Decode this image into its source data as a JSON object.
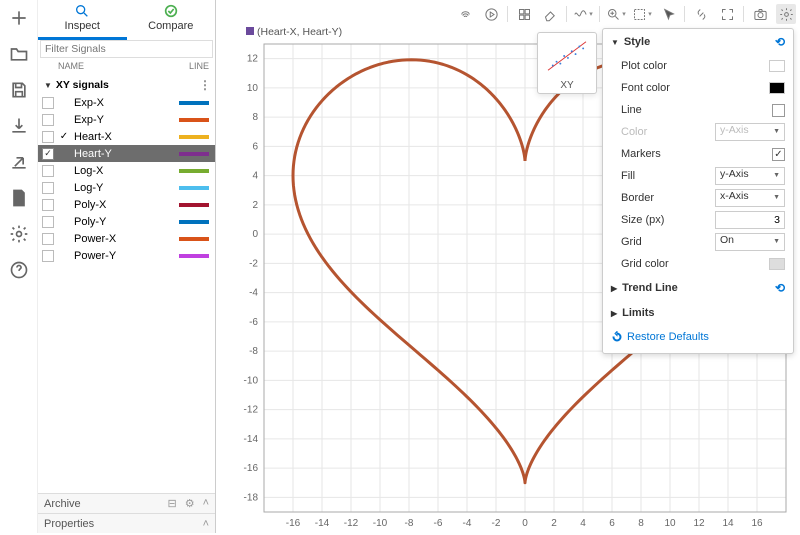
{
  "rail_tools": [
    "plus",
    "folder",
    "save",
    "download",
    "export",
    "document",
    "gear",
    "help"
  ],
  "tabs": {
    "inspect": "Inspect",
    "compare": "Compare"
  },
  "panel": {
    "filter_placeholder": "Filter Signals",
    "col_name": "NAME",
    "col_line": "LINE",
    "group": "XY signals",
    "signals": [
      {
        "name": "Exp-X",
        "color": "#0072bd",
        "checked": false,
        "sel": false,
        "tick": false
      },
      {
        "name": "Exp-Y",
        "color": "#d95319",
        "checked": false,
        "sel": false,
        "tick": false
      },
      {
        "name": "Heart-X",
        "color": "#edb120",
        "checked": false,
        "sel": false,
        "tick": true
      },
      {
        "name": "Heart-Y",
        "color": "#7e2f8e",
        "checked": true,
        "sel": true,
        "tick": false
      },
      {
        "name": "Log-X",
        "color": "#77ac30",
        "checked": false,
        "sel": false,
        "tick": false
      },
      {
        "name": "Log-Y",
        "color": "#4dbeee",
        "checked": false,
        "sel": false,
        "tick": false
      },
      {
        "name": "Poly-X",
        "color": "#a2142f",
        "checked": false,
        "sel": false,
        "tick": false
      },
      {
        "name": "Poly-Y",
        "color": "#0072bd",
        "checked": false,
        "sel": false,
        "tick": false
      },
      {
        "name": "Power-X",
        "color": "#d95319",
        "checked": false,
        "sel": false,
        "tick": false
      },
      {
        "name": "Power-Y",
        "color": "#c040e0",
        "checked": false,
        "sel": false,
        "tick": false
      }
    ],
    "archive": "Archive",
    "properties": "Properties"
  },
  "plot": {
    "title_pair": "(Heart-X, Heart-Y)",
    "x_ticks": [
      -16,
      -14,
      -12,
      -10,
      -8,
      -6,
      -4,
      -2,
      0,
      2,
      4,
      6,
      8,
      10,
      12,
      14,
      16
    ],
    "y_ticks": [
      -18,
      -16,
      -14,
      -12,
      -10,
      -8,
      -6,
      -4,
      -2,
      0,
      2,
      4,
      6,
      8,
      10,
      12
    ],
    "x_range": [
      -18,
      18
    ],
    "y_range": [
      -19,
      13
    ]
  },
  "popover": {
    "thumb_label": "XY",
    "style_head": "Style",
    "plot_color": "Plot color",
    "font_color": "Font color",
    "line": "Line",
    "color": "Color",
    "color_val": "y-Axis",
    "markers": "Markers",
    "fill": "Fill",
    "fill_val": "y-Axis",
    "border": "Border",
    "border_val": "x-Axis",
    "size": "Size (px)",
    "size_val": "3",
    "grid": "Grid",
    "grid_val": "On",
    "grid_color": "Grid color",
    "trend": "Trend Line",
    "limits": "Limits",
    "restore": "Restore Defaults"
  },
  "chart_data": {
    "type": "line",
    "title": "(Heart-X, Heart-Y)",
    "xlabel": "",
    "ylabel": "",
    "xlim": [
      -18,
      18
    ],
    "ylim": [
      -19,
      13
    ],
    "series": [
      {
        "name": "Heart",
        "parametric": true,
        "description": "Parametric heart curve x=16 sin^3 t, y=13 cos t - 5 cos 2t - 2 cos 3t - cos 4t, t in [0, 2π]",
        "x": [
          0.0,
          0.49,
          1.83,
          3.73,
          5.82,
          7.84,
          9.61,
          11.06,
          12.15,
          12.91,
          13.38,
          13.61,
          13.66,
          13.57,
          13.36,
          13.05,
          12.64,
          12.12,
          11.47,
          10.68,
          9.73,
          8.64,
          7.42,
          6.1,
          4.72,
          3.35,
          2.06,
          0.94,
          0.1,
          -0.1,
          -0.94,
          -2.06,
          -3.35,
          -4.72,
          -6.1,
          -7.42,
          -8.64,
          -9.73,
          -10.68,
          -11.47,
          -12.12,
          -12.64,
          -13.05,
          -13.36,
          -13.57,
          -13.66,
          -13.61,
          -13.38,
          -12.91,
          -12.15,
          -11.06,
          -9.61,
          -7.84,
          -5.82,
          -3.73,
          -1.83,
          -0.49,
          0.0
        ],
        "y": [
          5.0,
          6.76,
          8.48,
          10.0,
          11.12,
          11.75,
          11.9,
          11.64,
          11.09,
          10.33,
          9.44,
          8.47,
          7.43,
          6.33,
          5.15,
          3.87,
          2.48,
          0.99,
          -0.57,
          -2.18,
          -3.78,
          -5.31,
          -6.73,
          -8.01,
          -9.13,
          -10.12,
          -11.05,
          -12.03,
          -13.26,
          -13.26,
          -12.03,
          -11.05,
          -10.12,
          -9.13,
          -8.01,
          -6.73,
          -5.31,
          -3.78,
          -2.18,
          -0.57,
          0.99,
          2.48,
          3.87,
          5.15,
          6.33,
          7.43,
          8.47,
          9.44,
          10.33,
          11.09,
          11.64,
          11.9,
          11.75,
          11.12,
          10.0,
          8.48,
          6.76,
          5.0
        ]
      }
    ]
  }
}
